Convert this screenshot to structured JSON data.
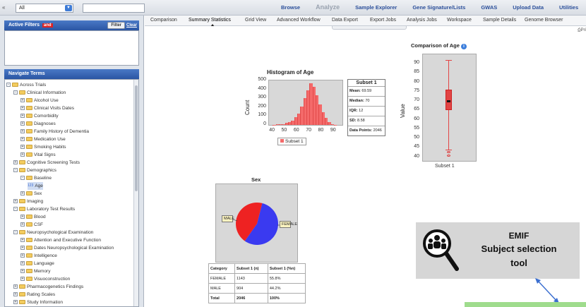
{
  "topbar": {
    "collapse_icon": "«",
    "study_select_value": "All",
    "search_value": "",
    "menu": [
      {
        "label": "Browse",
        "dim": false
      },
      {
        "label": "Analyze",
        "dim": true
      },
      {
        "label": "Sample Explorer",
        "dim": false
      },
      {
        "label": "Gene Signature/Lists",
        "dim": false
      },
      {
        "label": "GWAS",
        "dim": false
      },
      {
        "label": "Upload Data",
        "dim": false
      },
      {
        "label": "Utilities",
        "dim": false
      }
    ]
  },
  "sidebar": {
    "filters_title": "Active Filters",
    "filters_badge": "and",
    "filter_button": "Filter",
    "clear_link": "Clear",
    "terms_title": "Navigate Terms",
    "tree": [
      {
        "label": "Across Trials",
        "level": 0,
        "toggle": "-",
        "type": "folder"
      },
      {
        "label": "Clinical Information",
        "level": 1,
        "toggle": "-",
        "type": "folder"
      },
      {
        "label": "Alcohol Use",
        "level": 2,
        "toggle": "+",
        "type": "folder"
      },
      {
        "label": "Clinical Visits Dates",
        "level": 2,
        "toggle": "+",
        "type": "folder"
      },
      {
        "label": "Comorbidity",
        "level": 2,
        "toggle": "+",
        "type": "folder"
      },
      {
        "label": "Diagnoses",
        "level": 2,
        "toggle": "+",
        "type": "folder"
      },
      {
        "label": "Family History of Dementia",
        "level": 2,
        "toggle": "+",
        "type": "folder"
      },
      {
        "label": "Medication Use",
        "level": 2,
        "toggle": "+",
        "type": "folder"
      },
      {
        "label": "Smoking Habits",
        "level": 2,
        "toggle": "+",
        "type": "folder"
      },
      {
        "label": "Vital Signs",
        "level": 2,
        "toggle": "+",
        "type": "folder"
      },
      {
        "label": "Cognitive Screening Tests",
        "level": 1,
        "toggle": "+",
        "type": "folder"
      },
      {
        "label": "Demographics",
        "level": 1,
        "toggle": "-",
        "type": "folder"
      },
      {
        "label": "Baseline",
        "level": 2,
        "toggle": "-",
        "type": "folder"
      },
      {
        "label": "Age",
        "level": 3,
        "toggle": "",
        "type": "numeric",
        "selected": true
      },
      {
        "label": "Sex",
        "level": 2,
        "toggle": "+",
        "type": "folder"
      },
      {
        "label": "Imaging",
        "level": 1,
        "toggle": "+",
        "type": "folder"
      },
      {
        "label": "Laboratory Test Results",
        "level": 1,
        "toggle": "-",
        "type": "folder"
      },
      {
        "label": "Blood",
        "level": 2,
        "toggle": "+",
        "type": "folder"
      },
      {
        "label": "CSF",
        "level": 2,
        "toggle": "+",
        "type": "folder"
      },
      {
        "label": "Neuropsychological Examination",
        "level": 1,
        "toggle": "-",
        "type": "folder"
      },
      {
        "label": "Attention and Executive Function",
        "level": 2,
        "toggle": "+",
        "type": "folder"
      },
      {
        "label": "Dates Neuropsychological Examination",
        "level": 2,
        "toggle": "+",
        "type": "folder"
      },
      {
        "label": "Intelligence",
        "level": 2,
        "toggle": "+",
        "type": "folder"
      },
      {
        "label": "Language",
        "level": 2,
        "toggle": "+",
        "type": "folder"
      },
      {
        "label": "Memory",
        "level": 2,
        "toggle": "+",
        "type": "folder"
      },
      {
        "label": "Visuoconstruction",
        "level": 2,
        "toggle": "+",
        "type": "folder"
      },
      {
        "label": "Pharmacogenetics Findings",
        "level": 1,
        "toggle": "+",
        "type": "folder"
      },
      {
        "label": "Rating Scales",
        "level": 1,
        "toggle": "+",
        "type": "folder"
      },
      {
        "label": "Study Information",
        "level": 1,
        "toggle": "+",
        "type": "folder"
      }
    ]
  },
  "tabs": [
    {
      "label": "Comparison",
      "active": false
    },
    {
      "label": "Summary Statistics",
      "active": true
    },
    {
      "label": "Grid View",
      "active": false
    },
    {
      "label": "Advanced Workflow",
      "active": false
    },
    {
      "label": "Data Export",
      "active": false
    },
    {
      "label": "Export Jobs",
      "active": false
    },
    {
      "label": "Analysis Jobs",
      "active": false
    },
    {
      "label": "Workspace",
      "active": false
    },
    {
      "label": "Sample Details",
      "active": false
    },
    {
      "label": "Genome Browser",
      "active": false
    }
  ],
  "print_label": "Pri",
  "stats": {
    "title": "Subset 1",
    "rows": [
      {
        "label": "Mean:",
        "value": "69.59"
      },
      {
        "label": "Median:",
        "value": "70"
      },
      {
        "label": "IQR:",
        "value": "12"
      },
      {
        "label": "SD:",
        "value": "8.58"
      },
      {
        "label": "Data Points:",
        "value": "2046"
      }
    ]
  },
  "sex_table": {
    "headers": [
      "Category",
      "Subset 1 (n)",
      "Subset 1 (%n)"
    ],
    "rows": [
      [
        "FEMALE",
        "1143",
        "55.8%"
      ],
      [
        "MALE",
        "904",
        "44.2%"
      ]
    ],
    "total": [
      "Total",
      "2046",
      "100%"
    ]
  },
  "callout": {
    "line1": "EMIF",
    "line2": "Subject selection",
    "line3": "tool",
    "icon": "magnifier-people-icon"
  },
  "chart_data": [
    {
      "type": "bar",
      "title": "Histogram of Age",
      "xlabel": "",
      "ylabel": "Count",
      "x": [
        40,
        42.5,
        45,
        47.5,
        50,
        52.5,
        55,
        57.5,
        60,
        62.5,
        65,
        67.5,
        70,
        72.5,
        75,
        77.5,
        80,
        82.5,
        85,
        87.5,
        90
      ],
      "values": [
        3,
        5,
        8,
        12,
        20,
        30,
        50,
        85,
        130,
        210,
        300,
        390,
        470,
        430,
        330,
        230,
        140,
        80,
        35,
        12,
        4
      ],
      "xlim": [
        37,
        97
      ],
      "ylim": [
        0,
        500
      ],
      "xticks": [
        40,
        50,
        60,
        70,
        80,
        90
      ],
      "yticks": [
        0,
        100,
        200,
        300,
        400,
        500
      ],
      "legend": [
        "Subset 1"
      ],
      "color": "#f46a6a"
    },
    {
      "type": "box",
      "title": "Comparison of Age",
      "ylabel": "Value",
      "categories": [
        "Subset 1"
      ],
      "whisker_low": 44,
      "q1": 65,
      "median": 70,
      "q3": 76,
      "whisker_high": 92,
      "outliers": [
        41,
        43
      ],
      "ylim": [
        38,
        95
      ],
      "yticks": [
        40,
        45,
        50,
        55,
        60,
        65,
        70,
        75,
        80,
        85,
        90
      ],
      "color": "#e24444"
    },
    {
      "type": "pie",
      "title": "Sex",
      "labels": [
        "FEMALE",
        "MALE"
      ],
      "values": [
        55.8,
        44.2
      ],
      "colors": [
        "#3a3af0",
        "#ee2222"
      ]
    }
  ]
}
